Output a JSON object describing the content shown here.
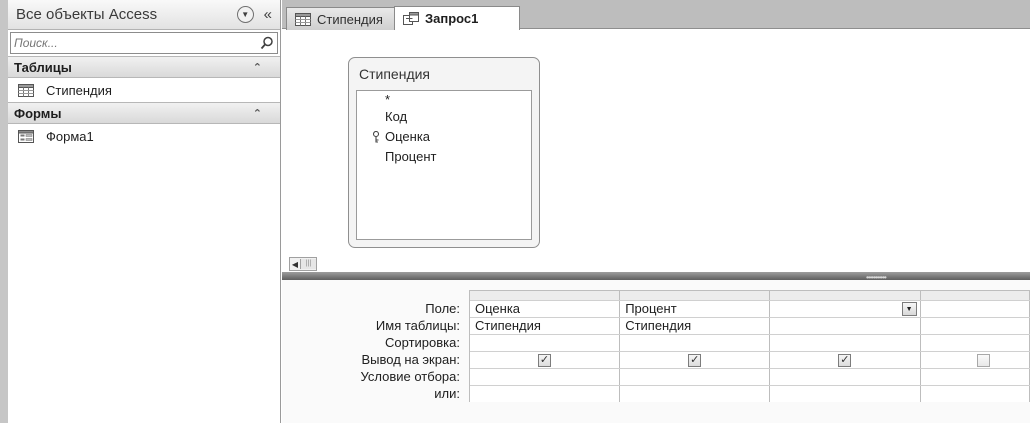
{
  "nav": {
    "title": "Все объекты Access",
    "dropdown_icon": "chevron-down-circle-icon",
    "collapse_icon": "double-chevron-left-icon",
    "search": {
      "placeholder": "Поиск..."
    },
    "groups": [
      {
        "label": "Таблицы",
        "items": [
          {
            "label": "Стипендия",
            "icon": "table-icon"
          }
        ]
      },
      {
        "label": "Формы",
        "items": [
          {
            "label": "Форма1",
            "icon": "form-icon"
          }
        ]
      }
    ]
  },
  "tabs": [
    {
      "label": "Стипендия",
      "icon": "table-icon",
      "active": false
    },
    {
      "label": "Запрос1",
      "icon": "query-icon",
      "active": true
    }
  ],
  "field_list": {
    "title": "Стипендия",
    "fields": [
      {
        "name": "*",
        "key": false
      },
      {
        "name": "Код",
        "key": false
      },
      {
        "name": "Оценка",
        "key": true
      },
      {
        "name": "Процент",
        "key": false
      }
    ]
  },
  "qbe": {
    "row_labels": [
      "Поле:",
      "Имя таблицы:",
      "Сортировка:",
      "Вывод на экран:",
      "Условие отбора:",
      "или:"
    ],
    "columns": [
      {
        "field": "Оценка",
        "table": "Стипендия",
        "sort": "",
        "show": true,
        "criteria": "",
        "or": ""
      },
      {
        "field": "Процент",
        "table": "Стипендия",
        "sort": "",
        "show": true,
        "criteria": "",
        "or": ""
      },
      {
        "field": "",
        "table": "",
        "sort": "",
        "show": true,
        "criteria": "",
        "or": ""
      },
      {
        "field": "",
        "table": "",
        "sort": "",
        "show": false,
        "criteria": "",
        "or": ""
      }
    ]
  }
}
